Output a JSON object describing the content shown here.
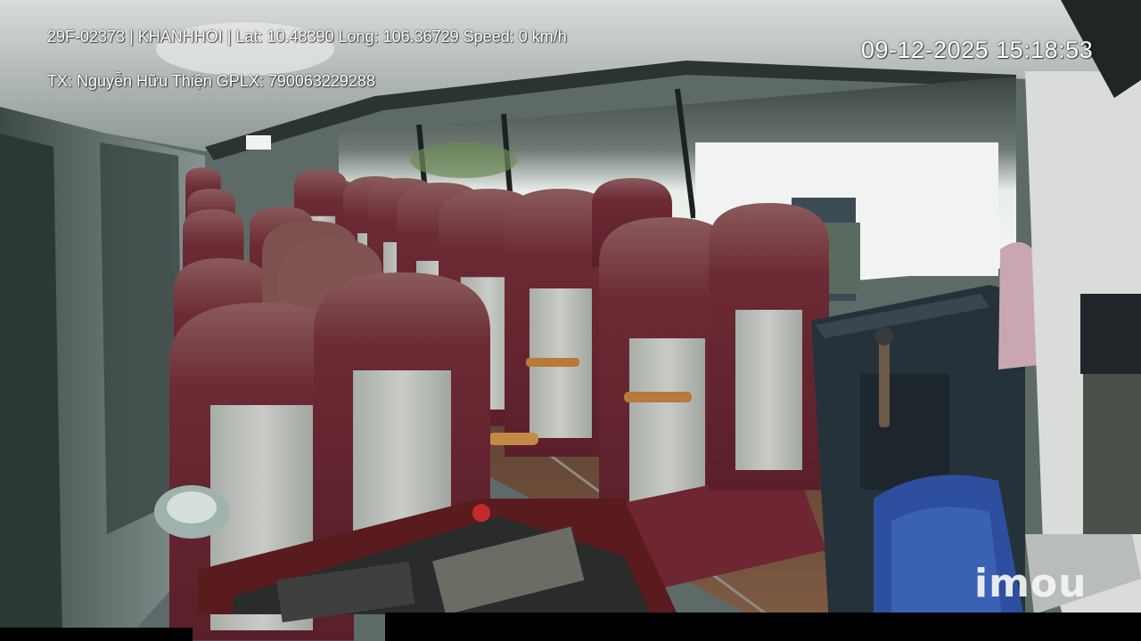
{
  "osd": {
    "line1": "29F-02373 | KHANHHOI | Lat: 10.48390 Long: 106.36729 Speed: 0 km/h",
    "line2": "TX: Nguyễn Hữu Thiện GPLX: 790063229288",
    "datetime": "09-12-2025 15:18:53"
  },
  "watermark": {
    "brand": "imou"
  },
  "colors": {
    "seat_maroon": "#6e2633",
    "seat_panel": "#b9bcb6",
    "floor": "#6b4a35",
    "ceiling": "#c7cbc6",
    "window_bright": "#eef2ee"
  }
}
